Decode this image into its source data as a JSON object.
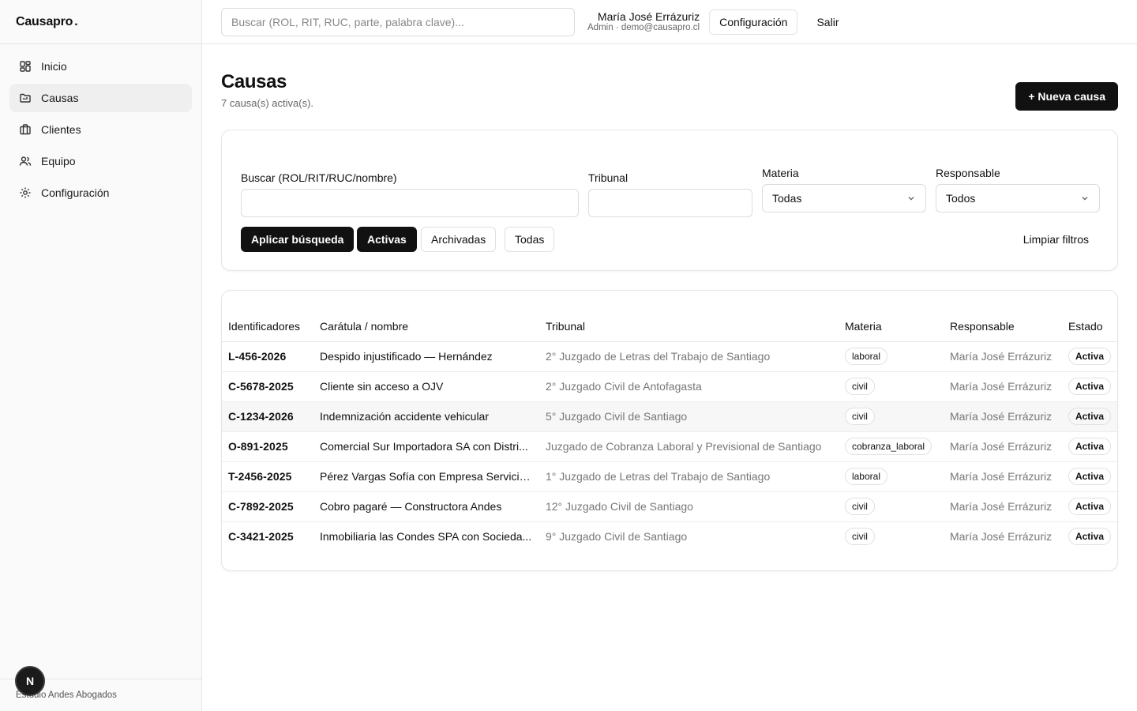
{
  "brand": {
    "name": "Causapro",
    "dot": "."
  },
  "sidebar": {
    "items": [
      {
        "label": "Inicio",
        "icon": "dashboard-grid-icon",
        "active": false
      },
      {
        "label": "Causas",
        "icon": "folder-icon",
        "active": true
      },
      {
        "label": "Clientes",
        "icon": "briefcase-icon",
        "active": false
      },
      {
        "label": "Equipo",
        "icon": "users-icon",
        "active": false
      },
      {
        "label": "Configuración",
        "icon": "gear-icon",
        "active": false
      }
    ],
    "footer": "Estudio Andes Abogados",
    "badge": "N"
  },
  "topbar": {
    "search_placeholder": "Buscar (ROL, RIT, RUC, parte, palabra clave)...",
    "user_name": "María José Errázuriz",
    "user_meta": "Admin · demo@causapro.cl",
    "config_label": "Configuración",
    "logout_label": "Salir"
  },
  "page": {
    "title": "Causas",
    "subtitle": "7 causa(s) activa(s).",
    "new_button": "+ Nueva causa"
  },
  "filters": {
    "search_label": "Buscar (ROL/RIT/RUC/nombre)",
    "search_value": "",
    "tribunal_label": "Tribunal",
    "tribunal_value": "",
    "materia_label": "Materia",
    "materia_value": "Todas",
    "responsable_label": "Responsable",
    "responsable_value": "Todos",
    "apply_label": "Aplicar búsqueda",
    "activas_label": "Activas",
    "archivadas_label": "Archivadas",
    "todas_label": "Todas",
    "clear_label": "Limpiar filtros"
  },
  "table": {
    "headers": [
      "Identificadores",
      "Carátula / nombre",
      "Tribunal",
      "Materia",
      "Responsable",
      "Estado"
    ],
    "rows": [
      {
        "id": "L-456-2026",
        "name": "Despido injustificado — Hernández",
        "tribunal": "2° Juzgado de Letras del Trabajo de Santiago",
        "materia": "laboral",
        "responsable": "María José Errázuriz",
        "estado": "Activa"
      },
      {
        "id": "C-5678-2025",
        "name": "Cliente sin acceso a OJV",
        "tribunal": "2° Juzgado Civil de Antofagasta",
        "materia": "civil",
        "responsable": "María José Errázuriz",
        "estado": "Activa"
      },
      {
        "id": "C-1234-2026",
        "name": "Indemnización accidente vehicular",
        "tribunal": "5° Juzgado Civil de Santiago",
        "materia": "civil",
        "responsable": "María José Errázuriz",
        "estado": "Activa"
      },
      {
        "id": "O-891-2025",
        "name": "Comercial Sur Importadora SA con Distri...",
        "tribunal": "Juzgado de Cobranza Laboral y Previsional de Santiago",
        "materia": "cobranza_laboral",
        "responsable": "María José Errázuriz",
        "estado": "Activa"
      },
      {
        "id": "T-2456-2025",
        "name": "Pérez Vargas Sofía con Empresa Servicio...",
        "tribunal": "1° Juzgado de Letras del Trabajo de Santiago",
        "materia": "laboral",
        "responsable": "María José Errázuriz",
        "estado": "Activa"
      },
      {
        "id": "C-7892-2025",
        "name": "Cobro pagaré — Constructora Andes",
        "tribunal": "12° Juzgado Civil de Santiago",
        "materia": "civil",
        "responsable": "María José Errázuriz",
        "estado": "Activa"
      },
      {
        "id": "C-3421-2025",
        "name": "Inmobiliaria las Condes SPA con Socieda...",
        "tribunal": "9° Juzgado Civil de Santiago",
        "materia": "civil",
        "responsable": "María José Errázuriz",
        "estado": "Activa"
      }
    ]
  }
}
